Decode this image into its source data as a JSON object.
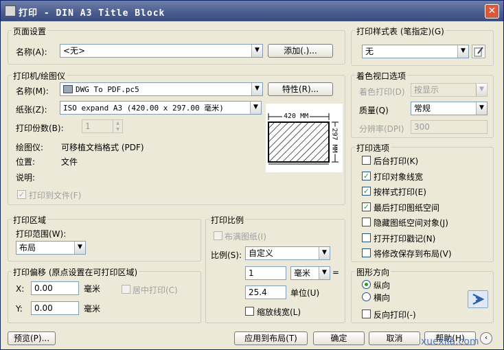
{
  "window": {
    "title": "打印 - DIN A3 Title Block",
    "close_glyph": "✕"
  },
  "page_setup": {
    "legend": "页面设置",
    "name_label": "名称(A):",
    "name_value": "<无>",
    "add_button": "添加(.)..."
  },
  "printer": {
    "legend": "打印机/绘图仪",
    "name_label": "名称(M):",
    "name_value": "DWG To PDF.pc5",
    "properties_button": "特性(R)...",
    "paper_label": "纸张(Z):",
    "paper_value": "ISO expand A3 (420.00 x 297.00 毫米)",
    "copies_label": "打印份数(B):",
    "copies_value": "1",
    "plotter_label": "绘图仪:",
    "plotter_value": "可移植文档格式 (PDF)",
    "where_label": "位置:",
    "where_value": "文件",
    "desc_label": "说明:",
    "plot_to_file_label": "打印到文件(F)",
    "preview_width": "420 MM",
    "preview_height": "297 MM"
  },
  "plot_area": {
    "legend": "打印区域",
    "range_label": "打印范围(W):",
    "range_value": "布局"
  },
  "plot_offset": {
    "legend": "打印偏移 (原点设置在可打印区域)",
    "x_label": "X:",
    "x_value": "0.00",
    "x_unit": "毫米",
    "y_label": "Y:",
    "y_value": "0.00",
    "y_unit": "毫米",
    "center_label": "居中打印(C)"
  },
  "plot_scale": {
    "legend": "打印比例",
    "fit_label": "布满图纸(I)",
    "scale_label": "比例(S):",
    "scale_value": "自定义",
    "value1": "1",
    "unit_value": "毫米",
    "equals": "=",
    "value2": "25.4",
    "units_label": "单位(U)",
    "lineweights_label": "缩放线宽(L)"
  },
  "style_table": {
    "legend": "打印样式表 (笔指定)(G)",
    "value": "无"
  },
  "shaded": {
    "legend": "着色视口选项",
    "shade_label": "着色打印(D)",
    "shade_value": "按显示",
    "quality_label": "质量(Q)",
    "quality_value": "常规",
    "dpi_label": "分辨率(DPI)",
    "dpi_value": "300"
  },
  "plot_options": {
    "legend": "打印选项",
    "items": [
      {
        "label": "后台打印(K)",
        "checked": false
      },
      {
        "label": "打印对象线宽",
        "checked": true
      },
      {
        "label": "按样式打印(E)",
        "checked": true
      },
      {
        "label": "最后打印图纸空间",
        "checked": true
      },
      {
        "label": "隐藏图纸空间对象(J)",
        "checked": false
      },
      {
        "label": "打开打印戳记(N)",
        "checked": false
      },
      {
        "label": "将修改保存到布局(V)",
        "checked": false
      }
    ]
  },
  "orientation": {
    "legend": "图形方向",
    "portrait": "纵向",
    "landscape": "横向",
    "upside_down": "反向打印(-)",
    "selected": "portrait"
  },
  "footer": {
    "preview": "预览(P)...",
    "apply": "应用到布局(T)",
    "ok": "确定",
    "cancel": "取消",
    "help": "帮助(H)",
    "watermark": "xuexila.com"
  },
  "colors": {
    "title_bar": "#4a5c8e",
    "dialog_bg": "#ece9d8",
    "check_mark": "#21a121",
    "close": "#d9583c"
  }
}
